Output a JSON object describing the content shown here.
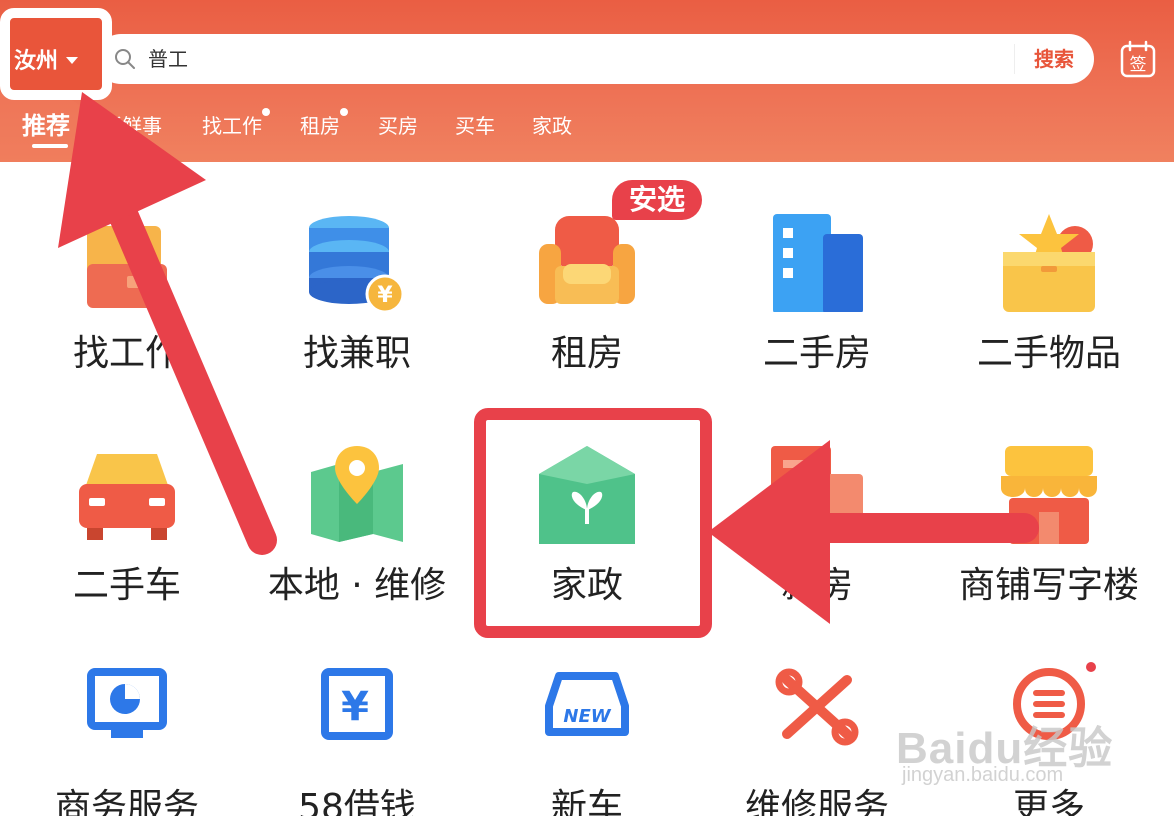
{
  "header": {
    "city": "汝州",
    "search_value": "普工",
    "search_button": "搜索",
    "sign_glyph": "签",
    "tabs": [
      {
        "label": "推荐",
        "active": true,
        "dot": false
      },
      {
        "label": "新鲜事",
        "active": false,
        "dot": false
      },
      {
        "label": "找工作",
        "active": false,
        "dot": true
      },
      {
        "label": "租房",
        "active": false,
        "dot": true
      },
      {
        "label": "买房",
        "active": false,
        "dot": false
      },
      {
        "label": "买车",
        "active": false,
        "dot": false
      },
      {
        "label": "家政",
        "active": false,
        "dot": false
      }
    ]
  },
  "grid": {
    "rows": [
      [
        {
          "label": "找工作",
          "icon": "briefcase-icon"
        },
        {
          "label": "找兼职",
          "icon": "coin-stack-icon"
        },
        {
          "label": "租房",
          "icon": "sofa-icon"
        },
        {
          "label": "二手房",
          "icon": "building-icon"
        },
        {
          "label": "二手物品",
          "icon": "box-star-icon"
        }
      ],
      [
        {
          "label": "二手车",
          "icon": "car-icon"
        },
        {
          "label": "本地 · 维修",
          "icon": "map-pin-icon"
        },
        {
          "label": "家政",
          "icon": "house-leaf-icon"
        },
        {
          "label": "新房",
          "icon": "new-house-icon"
        },
        {
          "label": "商铺写字楼",
          "icon": "shop-icon"
        }
      ],
      [
        {
          "label": "商务服务",
          "icon": "monitor-chart-icon"
        },
        {
          "label": "58借钱",
          "icon": "yen-card-icon"
        },
        {
          "label": "新车",
          "icon": "new-car-icon"
        },
        {
          "label": "维修服务",
          "icon": "tools-icon"
        },
        {
          "label": "更多",
          "icon": "menu-circle-icon"
        }
      ]
    ],
    "badge": "安选"
  },
  "watermark": {
    "line1": "Baidu经验",
    "line2": "jingyan.baidu.com"
  },
  "colors": {
    "brand": "#ea5e43",
    "annotation": "#e8414a"
  }
}
